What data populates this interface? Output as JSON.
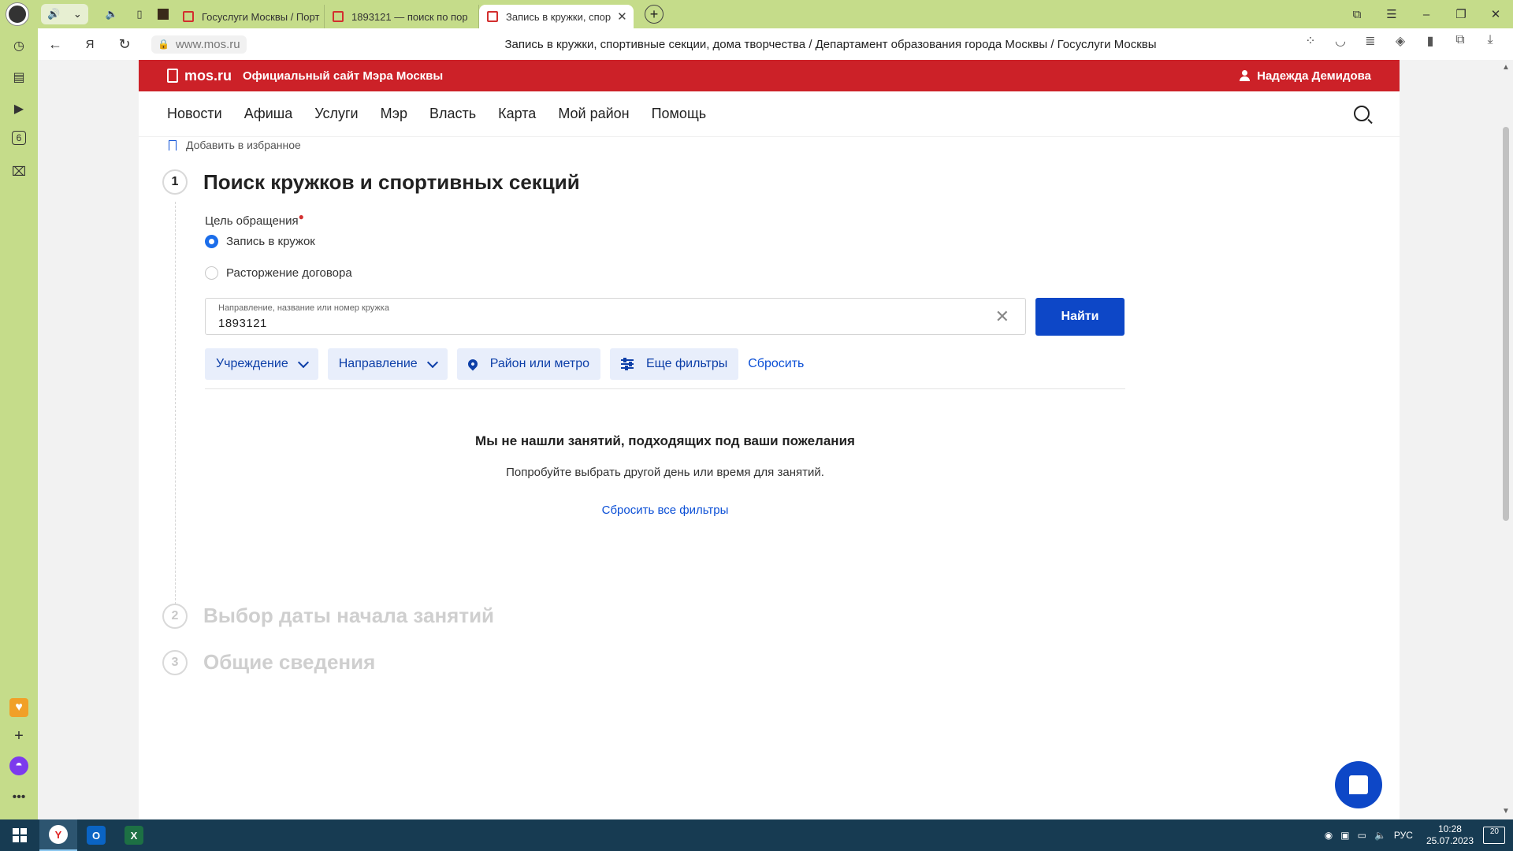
{
  "browser": {
    "tabs": [
      {
        "label": "Госуслуги Москвы / Порт",
        "active": false
      },
      {
        "label": "1893121 — поиск по пор",
        "active": false
      },
      {
        "label": "Запись в кружки, спор",
        "active": true
      }
    ],
    "url": "www.mos.ru",
    "page_title": "Запись в кружки, спортивные секции, дома творчества / Департамент образования города Москвы / Госуслуги Москвы"
  },
  "site": {
    "logo": "mos.ru",
    "official": "Официальный сайт Мэра Москвы",
    "user": "Надежда Демидова",
    "nav": [
      "Новости",
      "Афиша",
      "Услуги",
      "Мэр",
      "Власть",
      "Карта",
      "Мой район",
      "Помощь"
    ],
    "favorite": "Добавить в избранное"
  },
  "steps": [
    {
      "num": "1",
      "title": "Поиск кружков и спортивных секций"
    },
    {
      "num": "2",
      "title": "Выбор даты начала занятий"
    },
    {
      "num": "3",
      "title": "Общие сведения"
    }
  ],
  "form": {
    "goal_label": "Цель обращения",
    "options": [
      "Запись в кружок",
      "Расторжение договора"
    ],
    "selected": "Запись в кружок",
    "search_label": "Направление, название или номер кружка",
    "search_value": "1893121",
    "find_button": "Найти",
    "filters": [
      "Учреждение",
      "Направление",
      "Район или метро",
      "Еще фильтры"
    ],
    "reset": "Сбросить"
  },
  "empty": {
    "title": "Мы не нашли занятий, подходящих под ваши пожелания",
    "subtitle": "Попробуйте выбрать другой день или время для занятий.",
    "reset_all": "Сбросить все фильтры"
  },
  "taskbar": {
    "lang": "РУС",
    "time": "10:28",
    "date": "25.07.2023",
    "notifications": "20"
  },
  "colors": {
    "brand_red": "#cc2128",
    "primary_blue": "#0d47c7",
    "browser_chrome": "#c5dc8a"
  }
}
